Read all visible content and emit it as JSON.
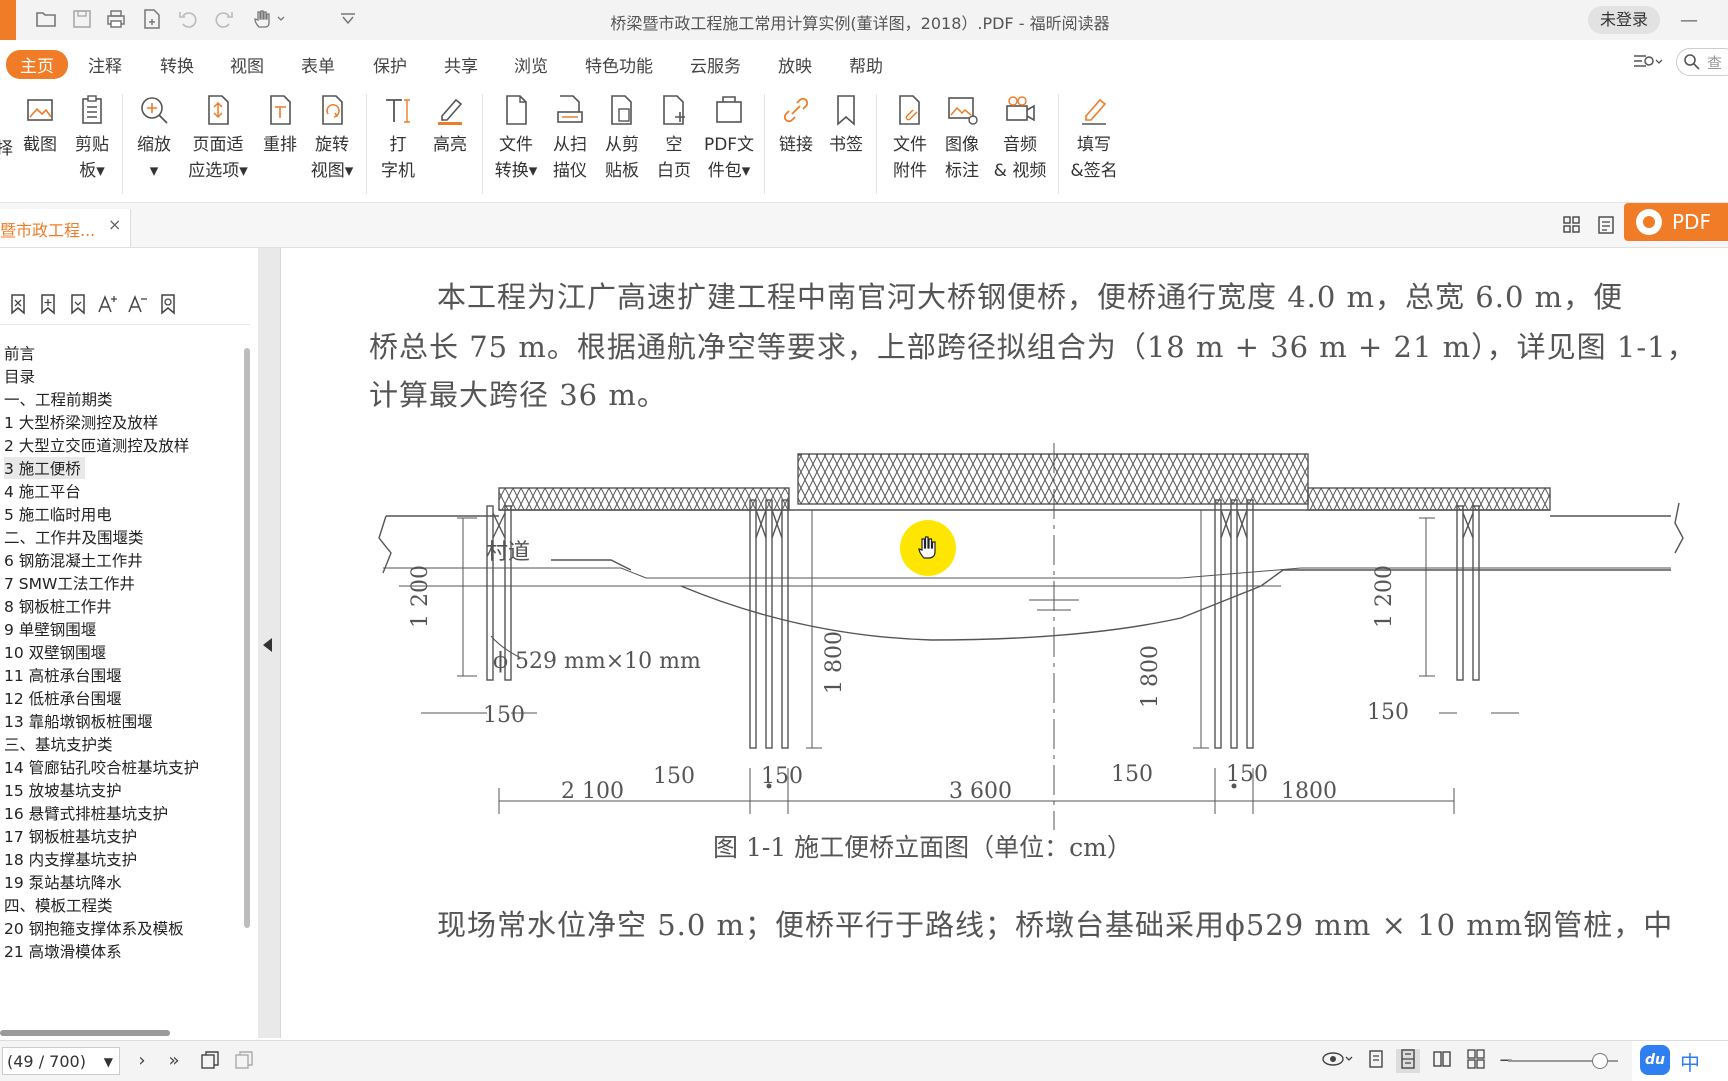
{
  "window": {
    "title": "桥梁暨市政工程施工常用计算实例(董详图，2018）.PDF - 福昕阅读器",
    "login_label": "未登录",
    "minimize": "—"
  },
  "menu": {
    "tabs": [
      "主页",
      "注释",
      "转换",
      "视图",
      "表单",
      "保护",
      "共享",
      "浏览",
      "特色功能",
      "云服务",
      "放映",
      "帮助"
    ],
    "active": "主页",
    "search_placeholder": "查"
  },
  "ribbon": {
    "buttons": [
      {
        "line1": "截图",
        "line2": ""
      },
      {
        "line1": "剪贴",
        "line2": "板▾"
      },
      {
        "line1": "缩放",
        "line2": "▾"
      },
      {
        "line1": "页面适",
        "line2": "应选项▾"
      },
      {
        "line1": "重排",
        "line2": ""
      },
      {
        "line1": "旋转",
        "line2": "视图▾"
      },
      {
        "line1": "打",
        "line2": "字机"
      },
      {
        "line1": "高亮",
        "line2": ""
      },
      {
        "line1": "文件",
        "line2": "转换▾"
      },
      {
        "line1": "从扫",
        "line2": "描仪"
      },
      {
        "line1": "从剪",
        "line2": "贴板"
      },
      {
        "line1": "空",
        "line2": "白页"
      },
      {
        "line1": "PDF文",
        "line2": "件包▾"
      },
      {
        "line1": "链接",
        "line2": ""
      },
      {
        "line1": "书签",
        "line2": ""
      },
      {
        "line1": "文件",
        "line2": "附件"
      },
      {
        "line1": "图像",
        "line2": "标注"
      },
      {
        "line1": "音频",
        "line2": "& 视频"
      },
      {
        "line1": "填写",
        "line2": "&签名"
      }
    ],
    "partial_left_label": "择"
  },
  "tabbar": {
    "doc_tab_label": "暨市政工程...",
    "close": "×",
    "promo_label": "PDF"
  },
  "sidebar": {
    "toc": [
      "前言",
      "目录",
      "一、工程前期类",
      "1  大型桥梁测控及放样",
      "2  大型立交匝道测控及放样",
      "3  施工便桥",
      "4  施工平台",
      "5  施工临时用电",
      "二、工作井及围堰类",
      "6  钢筋混凝土工作井",
      "7  SMW工法工作井",
      "8  钢板桩工作井",
      "9  单壁钢围堰",
      "10  双壁钢围堰",
      "11  高桩承台围堰",
      "12  低桩承台围堰",
      "13  靠船墩钢板桩围堰",
      "三、基坑支护类",
      "14  管廊钻孔咬合桩基坑支护",
      "15  放坡基坑支护",
      "16  悬臂式排桩基坑支护",
      "17  钢板桩基坑支护",
      "18  内支撑基坑支护",
      "19  泵站基坑降水",
      "四、模板工程类",
      "20  钢抱箍支撑体系及模板",
      "21  高墩滑模体系"
    ],
    "selected_index": 5
  },
  "document": {
    "para1_line1": "本工程为江广高速扩建工程中南官河大桥钢便桥，便桥通行宽度 4.0 m，总宽 6.0 m，便",
    "para1_line2": "桥总长 75 m。根据通航净空等要求，上部跨径拟组合为（18 m + 36 m + 21 m），详见图 1-1，",
    "para1_line3": "计算最大跨径 36 m。",
    "para2_line1": "现场常水位净空  5.0 m；便桥平行于路线；桥墩台基础采用ϕ529 mm × 10  mm钢管桩，中",
    "figure": {
      "road_label": "村道",
      "pile_label": "ϕ 529 mm×10 mm",
      "dim_1200_left": "1 200",
      "dim_1200_right": "1 200",
      "dim_1800_a": "1 800",
      "dim_1800_b": "1 800",
      "dim_150_a": "150",
      "dim_150_b": "150",
      "dim_150_c": "150",
      "dim_150_d": "150",
      "dim_150_e": "150",
      "dim_150_f": "150",
      "span_left": "2 100",
      "span_mid": "3 600",
      "span_right": "1800",
      "caption": "图 1-1    施工便桥立面图（单位：cm）"
    }
  },
  "statusbar": {
    "page_indicator": "(49 / 700)",
    "ime_brand": "du",
    "ime_lang": "中"
  },
  "colors": {
    "accent": "#f07c28",
    "cursor_highlight": "#ffe600",
    "ime_blue": "#2f7ff0"
  }
}
